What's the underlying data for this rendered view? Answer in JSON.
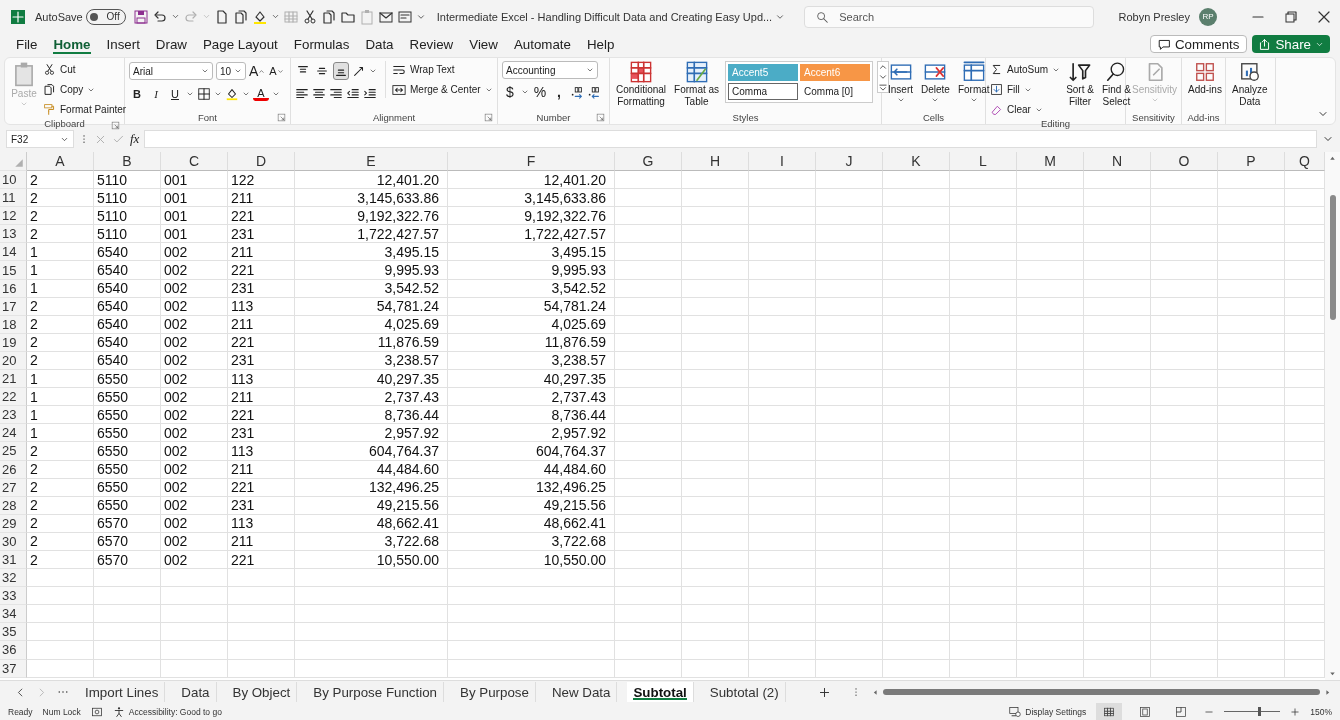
{
  "title_bar": {
    "autosave": {
      "label": "AutoSave",
      "on": false,
      "state": "Off"
    },
    "document_title": "Intermediate Excel - Handling Difficult Data and Creating Easy Upd...",
    "search": {
      "placeholder": "Search"
    },
    "user": "Robyn Presley",
    "initials": "RP"
  },
  "menu_tabs": [
    {
      "label": "File",
      "selected": false
    },
    {
      "label": "Home",
      "selected": true
    },
    {
      "label": "Insert",
      "selected": false
    },
    {
      "label": "Draw",
      "selected": false
    },
    {
      "label": "Page Layout",
      "selected": false
    },
    {
      "label": "Formulas",
      "selected": false
    },
    {
      "label": "Data",
      "selected": false
    },
    {
      "label": "Review",
      "selected": false
    },
    {
      "label": "View",
      "selected": false
    },
    {
      "label": "Automate",
      "selected": false
    },
    {
      "label": "Help",
      "selected": false
    }
  ],
  "comments": "Comments",
  "share": "Share",
  "ribbon": {
    "clipboard": {
      "label": "Clipboard",
      "paste": {
        "label": "Paste",
        "disabled": true
      },
      "buttons": [
        {
          "label": "Cut",
          "dropdown": false
        },
        {
          "label": "Copy",
          "dropdown": true
        },
        {
          "label": "Format Painter",
          "dropdown": false
        }
      ]
    },
    "font": {
      "label": "Font",
      "font_name": "Arial",
      "font_size": "10",
      "grow": "A",
      "shrink": "A",
      "styles": [
        "B",
        "I",
        "U"
      ],
      "font_color_letter": "A"
    },
    "alignment": {
      "label": "Alignment",
      "wrap_text": "Wrap Text",
      "merge": "Merge & Center",
      "vertical": [
        {
          "selected": false
        },
        {
          "selected": false
        },
        {
          "selected": true
        }
      ]
    },
    "number": {
      "label": "Number",
      "format": "Accounting",
      "currency": "$",
      "percent": "%",
      "comma": ","
    },
    "styles": {
      "label": "Styles",
      "conditional": [
        "Conditional",
        "Formatting"
      ],
      "table": [
        "Format as",
        "Table"
      ],
      "gallery": [
        {
          "label": "Accent5",
          "color": "#4bacc6",
          "selected": false
        },
        {
          "label": "Accent6",
          "color": "#f79646",
          "selected": false
        },
        {
          "label": "Comma",
          "selected": true
        },
        {
          "label": "Comma [0]",
          "selected": false
        }
      ]
    },
    "cells": {
      "label": "Cells",
      "buttons": [
        "Insert",
        "Delete",
        "Format"
      ]
    },
    "editing": {
      "label": "Editing",
      "small": [
        "AutoSum",
        "Fill",
        "Clear"
      ],
      "large": [
        [
          "Sort &",
          "Filter"
        ],
        [
          "Find &",
          "Select"
        ]
      ]
    },
    "sensitivity": {
      "label": "Sensitivity",
      "button": "Sensitivity",
      "disabled": true
    },
    "addins": {
      "label": "Add-ins",
      "button": "Add-ins"
    },
    "analyze": {
      "button": [
        "Analyze",
        "Data"
      ]
    }
  },
  "formula_bar": {
    "name_box": "F32",
    "fx": "fx"
  },
  "sheet": {
    "columns": [
      "A",
      "B",
      "C",
      "D",
      "E",
      "F",
      "G",
      "H",
      "I",
      "J",
      "K",
      "L",
      "M",
      "N",
      "O",
      "P",
      "Q"
    ],
    "rows": [
      {
        "number": "10",
        "cells": [
          "2",
          "5110",
          "001",
          "122",
          "12,401.20",
          "12,401.20"
        ]
      },
      {
        "number": "11",
        "cells": [
          "2",
          "5110",
          "001",
          "211",
          "3,145,633.86",
          "3,145,633.86"
        ]
      },
      {
        "number": "12",
        "cells": [
          "2",
          "5110",
          "001",
          "221",
          "9,192,322.76",
          "9,192,322.76"
        ]
      },
      {
        "number": "13",
        "cells": [
          "2",
          "5110",
          "001",
          "231",
          "1,722,427.57",
          "1,722,427.57"
        ]
      },
      {
        "number": "14",
        "cells": [
          "1",
          "6540",
          "002",
          "211",
          "3,495.15",
          "3,495.15"
        ]
      },
      {
        "number": "15",
        "cells": [
          "1",
          "6540",
          "002",
          "221",
          "9,995.93",
          "9,995.93"
        ]
      },
      {
        "number": "16",
        "cells": [
          "1",
          "6540",
          "002",
          "231",
          "3,542.52",
          "3,542.52"
        ]
      },
      {
        "number": "17",
        "cells": [
          "2",
          "6540",
          "002",
          "113",
          "54,781.24",
          "54,781.24"
        ]
      },
      {
        "number": "18",
        "cells": [
          "2",
          "6540",
          "002",
          "211",
          "4,025.69",
          "4,025.69"
        ]
      },
      {
        "number": "19",
        "cells": [
          "2",
          "6540",
          "002",
          "221",
          "11,876.59",
          "11,876.59"
        ]
      },
      {
        "number": "20",
        "cells": [
          "2",
          "6540",
          "002",
          "231",
          "3,238.57",
          "3,238.57"
        ]
      },
      {
        "number": "21",
        "cells": [
          "1",
          "6550",
          "002",
          "113",
          "40,297.35",
          "40,297.35"
        ]
      },
      {
        "number": "22",
        "cells": [
          "1",
          "6550",
          "002",
          "211",
          "2,737.43",
          "2,737.43"
        ]
      },
      {
        "number": "23",
        "cells": [
          "1",
          "6550",
          "002",
          "221",
          "8,736.44",
          "8,736.44"
        ]
      },
      {
        "number": "24",
        "cells": [
          "1",
          "6550",
          "002",
          "231",
          "2,957.92",
          "2,957.92"
        ]
      },
      {
        "number": "25",
        "cells": [
          "2",
          "6550",
          "002",
          "113",
          "604,764.37",
          "604,764.37"
        ]
      },
      {
        "number": "26",
        "cells": [
          "2",
          "6550",
          "002",
          "211",
          "44,484.60",
          "44,484.60"
        ]
      },
      {
        "number": "27",
        "cells": [
          "2",
          "6550",
          "002",
          "221",
          "132,496.25",
          "132,496.25"
        ]
      },
      {
        "number": "28",
        "cells": [
          "2",
          "6550",
          "002",
          "231",
          "49,215.56",
          "49,215.56"
        ]
      },
      {
        "number": "29",
        "cells": [
          "2",
          "6570",
          "002",
          "113",
          "48,662.41",
          "48,662.41"
        ]
      },
      {
        "number": "30",
        "cells": [
          "2",
          "6570",
          "002",
          "211",
          "3,722.68",
          "3,722.68"
        ]
      },
      {
        "number": "31",
        "cells": [
          "2",
          "6570",
          "002",
          "221",
          "10,550.00",
          "10,550.00"
        ]
      },
      {
        "number": "32",
        "cells": []
      },
      {
        "number": "33",
        "cells": []
      },
      {
        "number": "34",
        "cells": []
      },
      {
        "number": "35",
        "cells": []
      },
      {
        "number": "36",
        "cells": []
      },
      {
        "number": "37",
        "cells": []
      }
    ]
  },
  "sheet_tabs": [
    {
      "label": "Import Lines",
      "selected": false
    },
    {
      "label": "Data",
      "selected": false
    },
    {
      "label": "By Object",
      "selected": false
    },
    {
      "label": "By Purpose Function",
      "selected": false
    },
    {
      "label": "By Purpose",
      "selected": false
    },
    {
      "label": "New Data",
      "selected": false
    },
    {
      "label": "Subtotal",
      "selected": true
    },
    {
      "label": "Subtotal (2)",
      "selected": false
    }
  ],
  "status_bar": {
    "ready": "Ready",
    "num_lock": "Num Lock",
    "accessibility": "Accessibility: Good to go",
    "display_settings": "Display Settings",
    "views": [
      {
        "selected": true
      },
      {
        "selected": false
      },
      {
        "selected": false
      }
    ],
    "zoom_slider": {
      "level": 0.6
    },
    "zoom": "150%"
  }
}
